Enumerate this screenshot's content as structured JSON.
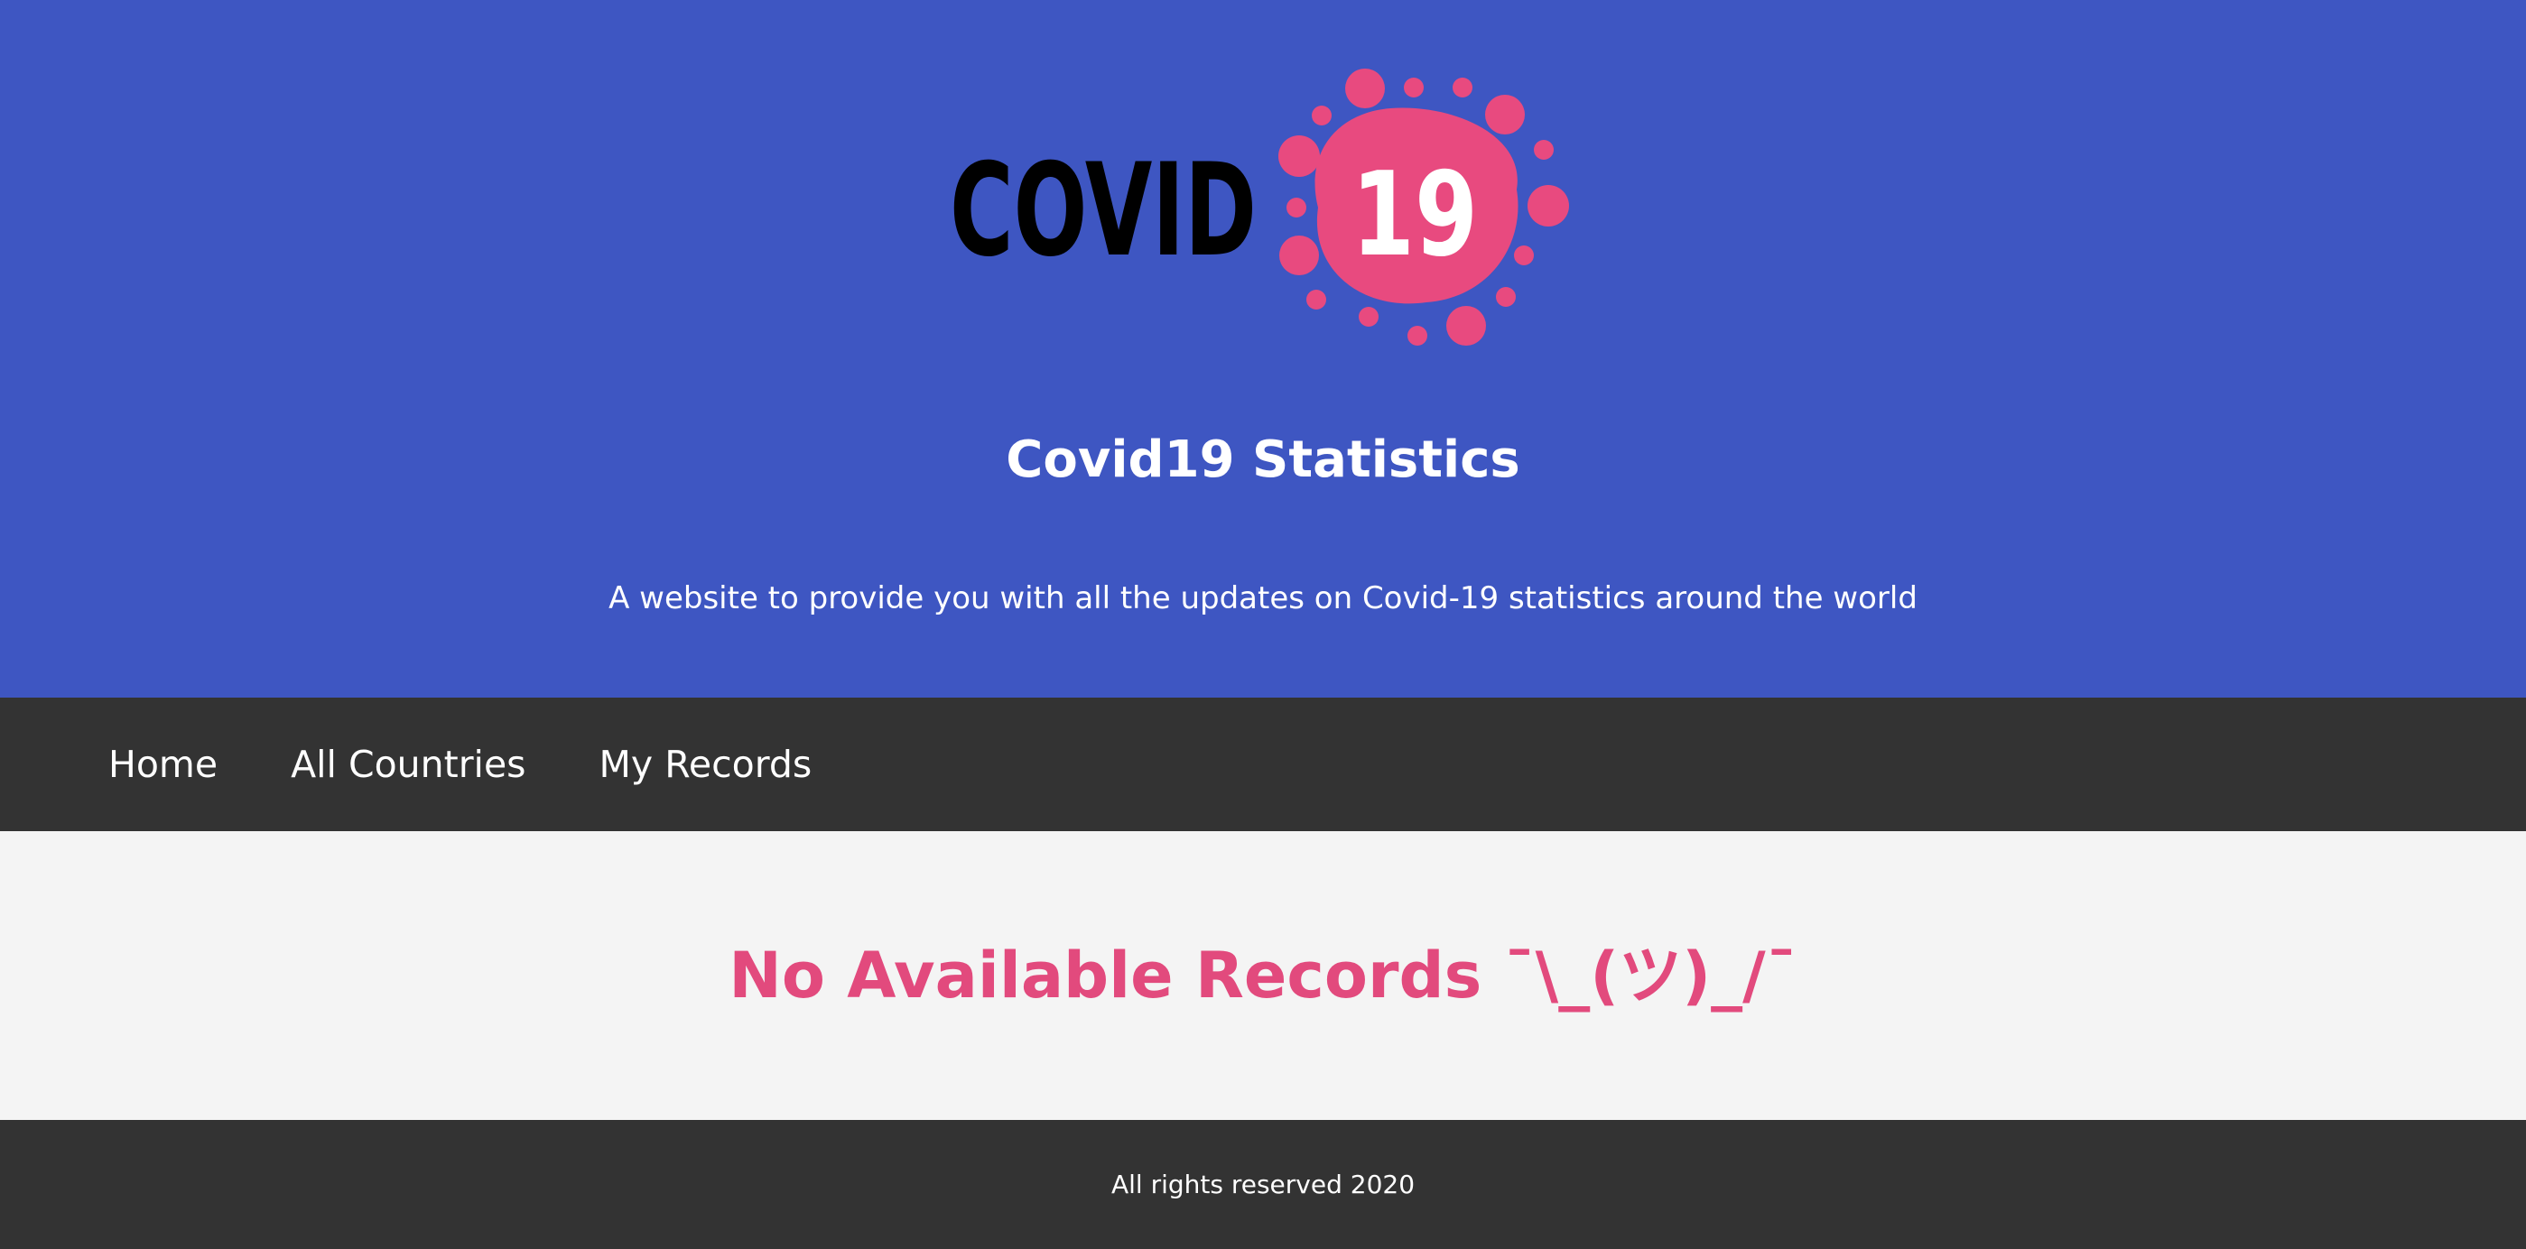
{
  "header": {
    "logo": {
      "word": "COVID",
      "number": "19",
      "icon": "virus-icon",
      "word_color": "#000000",
      "virus_color": "#e84a7f"
    },
    "title": "Covid19 Statistics",
    "tagline": "A website to provide you with all the updates on Covid-19 statistics around the world"
  },
  "nav": {
    "items": [
      {
        "label": "Home"
      },
      {
        "label": "All Countries"
      },
      {
        "label": "My Records"
      }
    ]
  },
  "main": {
    "message": "No Available Records ¯\\_(ツ)_/¯"
  },
  "footer": {
    "text": "All rights reserved 2020"
  },
  "colors": {
    "hero_bg": "#3e56c2",
    "nav_bg": "#333333",
    "content_bg": "#f4f4f4",
    "accent": "#e24a7d"
  }
}
